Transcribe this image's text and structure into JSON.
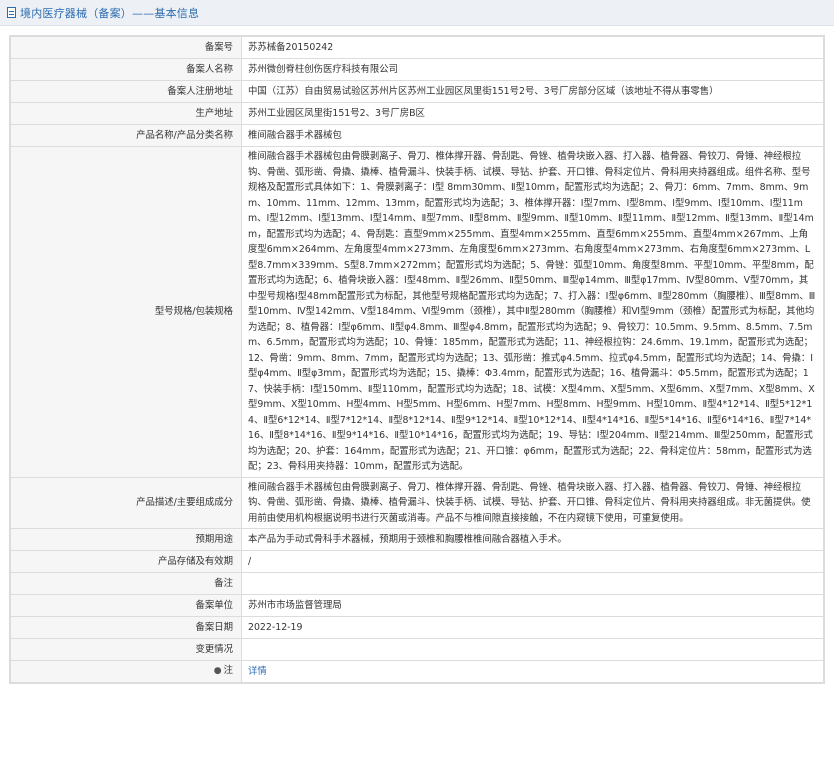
{
  "header": {
    "title": "境内医疗器械（备案）——基本信息"
  },
  "rows": {
    "record_no": {
      "label": "备案号",
      "value": "苏苏械备20150242"
    },
    "filer_name": {
      "label": "备案人名称",
      "value": "苏州微创脊柱创伤医疗科技有限公司"
    },
    "filer_address": {
      "label": "备案人注册地址",
      "value": "中国（江苏）自由贸易试验区苏州片区苏州工业园区凤里街151号2号、3号厂房部分区域（该地址不得从事零售）"
    },
    "production_address": {
      "label": "生产地址",
      "value": "苏州工业园区凤里街151号2、3号厂房B区"
    },
    "product_name": {
      "label": "产品名称/产品分类名称",
      "value": "椎间融合器手术器械包"
    },
    "model_spec": {
      "label": "型号规格/包装规格",
      "value": "椎间融合器手术器械包由骨膜剥离子、骨刀、椎体撑开器、骨刮匙、骨锉、植骨块嵌入器、打入器、植骨器、骨铰刀、骨锤、神经根拉钩、骨凿、弧形凿、骨撬、撬棒、植骨漏斗、快装手柄、试模、导钻、护套、开口锥、骨科定位片、骨科用夹持器组成。组件名称、型号规格及配置形式具体如下：1、骨膜剥离子：Ⅰ型 8mm30mm、Ⅱ型10mm，配置形式均为选配；2、骨刀：6mm、7mm、8mm、9mm、10mm、11mm、12mm、13mm，配置形式均为选配；3、椎体撑开器：Ⅰ型7mm、Ⅰ型8mm、Ⅰ型9mm、Ⅰ型10mm、Ⅰ型11mm、Ⅰ型12mm、Ⅰ型13mm、Ⅰ型14mm、Ⅱ型7mm、Ⅱ型8mm、Ⅱ型9mm、Ⅱ型10mm、Ⅱ型11mm、Ⅱ型12mm、Ⅱ型13mm、Ⅱ型14mm，配置形式均为选配；4、骨刮匙：直型9mm×255mm、直型4mm×255mm、直型6mm×255mm、直型4mm×267mm、上角度型6mm×264mm、左角度型4mm×273mm、左角度型6mm×273mm、右角度型4mm×273mm、右角度型6mm×273mm、L型8.7mm×339mm、S型8.7mm×272mm；配置形式均为选配；5、骨锉：弧型10mm、角度型8mm、平型10mm、平型8mm，配置形式均为选配；6、植骨块嵌入器：Ⅰ型48mm、Ⅱ型26mm、Ⅱ型50mm、Ⅲ型φ14mm、Ⅲ型φ17mm、Ⅳ型80mm、Ⅴ型70mm，其中型号规格Ⅰ型48mm配置形式为标配，其他型号规格配置形式均为选配；7、打入器：Ⅰ型φ6mm、Ⅱ型280mm（胸腰椎）、Ⅲ型8mm、Ⅲ型10mm、Ⅳ型142mm、Ⅴ型184mm、Ⅵ型9mm（颈椎），其中Ⅱ型280mm（胸腰椎）和Ⅵ型9mm（颈椎）配置形式为标配，其他均为选配；8、植骨器：Ⅰ型φ6mm、Ⅱ型φ4.8mm、Ⅲ型φ4.8mm，配置形式均为选配；9、骨铰刀：10.5mm、9.5mm、8.5mm、7.5mm、6.5mm，配置形式均为选配；10、骨锤：185mm，配置形式为选配；11、神经根拉钩：24.6mm、19.1mm，配置形式为选配；12、骨凿：9mm、8mm、7mm，配置形式均为选配；13、弧形凿：推式φ4.5mm、拉式φ4.5mm，配置形式均为选配；14、骨撬：Ⅰ型φ4mm、Ⅱ型φ3mm，配置形式均为选配；15、撬棒：Φ3.4mm，配置形式为选配；16、植骨漏斗：Φ5.5mm，配置形式为选配；17、快装手柄：Ⅰ型150mm、Ⅱ型110mm，配置形式均为选配；18、试模：X型4mm、X型5mm、X型6mm、X型7mm、X型8mm、X型9mm、X型10mm、H型4mm、H型5mm、H型6mm、H型7mm、H型8mm、H型9mm、H型10mm、Ⅱ型4*12*14、Ⅱ型5*12*14、Ⅱ型6*12*14、Ⅱ型7*12*14、Ⅱ型8*12*14、Ⅱ型9*12*14、Ⅱ型10*12*14、Ⅱ型4*14*16、Ⅱ型5*14*16、Ⅱ型6*14*16、Ⅱ型7*14*16、Ⅱ型8*14*16、Ⅱ型9*14*16、Ⅱ型10*14*16，配置形式均为选配；19、导钻：Ⅰ型204mm、Ⅱ型214mm、Ⅲ型250mm，配置形式均为选配；20、护套：164mm，配置形式为选配；21、开口锥：φ6mm，配置形式为选配；22、骨科定位片：58mm，配置形式为选配；23、骨科用夹持器：10mm，配置形式为选配。"
    },
    "description": {
      "label": "产品描述/主要组成成分",
      "value": "椎间融合器手术器械包由骨膜剥离子、骨刀、椎体撑开器、骨刮匙、骨锉、植骨块嵌入器、打入器、植骨器、骨铰刀、骨锤、神经根拉钩、骨凿、弧形凿、骨撬、撬棒、植骨漏斗、快装手柄、试模、导钻、护套、开口锥、骨科定位片、骨科用夹持器组成。非无菌提供。使用前由使用机构根据说明书进行灭菌或消毒。产品不与椎间隙直接接触，不在内窥镜下使用，可重复使用。"
    },
    "intended_use": {
      "label": "预期用途",
      "value": "本产品为手动式骨科手术器械，预期用于颈椎和胸腰椎椎间融合器植入手术。"
    },
    "storage": {
      "label": "产品存储及有效期",
      "value": "/"
    },
    "remark": {
      "label": "备注",
      "value": ""
    },
    "record_unit": {
      "label": "备案单位",
      "value": "苏州市市场监督管理局"
    },
    "record_date": {
      "label": "备案日期",
      "value": "2022-12-19"
    },
    "change_info": {
      "label": "变更情况",
      "value": ""
    },
    "note": {
      "label": "注",
      "value": "详情"
    }
  },
  "colors": {
    "link": "#2b6cb0",
    "label_bg": "#f6f6f6",
    "border": "#dcdcdc"
  },
  "icons": {
    "header": "document-icon",
    "note": "lightbulb-icon"
  }
}
